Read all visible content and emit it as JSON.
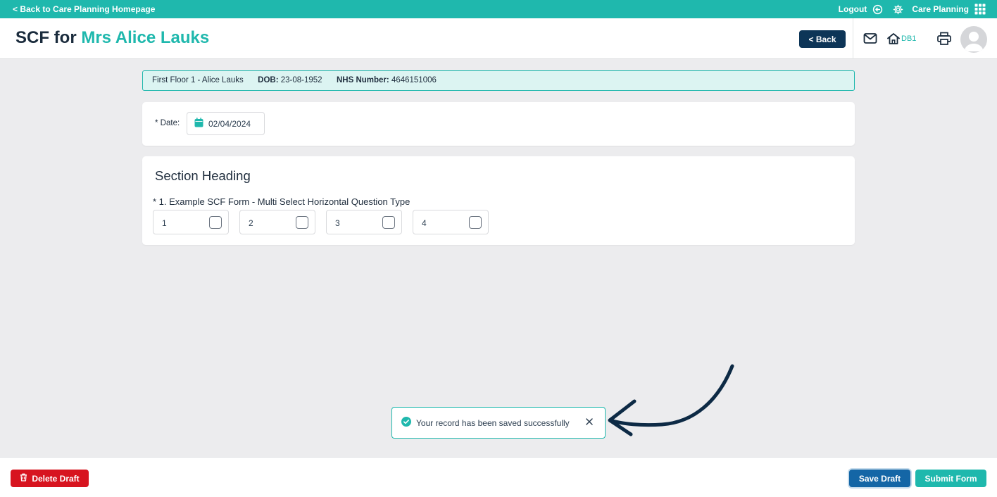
{
  "topbar": {
    "back_link": "< Back to Care Planning Homepage",
    "logout": "Logout",
    "app_name": "Care Planning"
  },
  "header": {
    "title_prefix": "SCF for",
    "patient_name": "Mrs Alice Lauks",
    "back_button": "< Back",
    "home_code": "DB1"
  },
  "patient_bar": {
    "location": "First Floor 1 - Alice Lauks",
    "dob_label": "DOB:",
    "dob_value": "23-08-1952",
    "nhs_label": "NHS Number:",
    "nhs_value": "4646151006"
  },
  "date_field": {
    "label": "* Date:",
    "value": "02/04/2024"
  },
  "section": {
    "heading": "Section Heading",
    "question": "* 1. Example SCF Form - Multi Select Horizontal Question Type",
    "options": [
      {
        "label": "1",
        "checked": false
      },
      {
        "label": "2",
        "checked": false
      },
      {
        "label": "3",
        "checked": false
      },
      {
        "label": "4",
        "checked": false
      }
    ]
  },
  "toast": {
    "message": "Your record has been saved successfully"
  },
  "footer": {
    "delete_label": "Delete Draft",
    "save_label": "Save Draft",
    "submit_label": "Submit Form"
  },
  "colors": {
    "accent": "#1fb8ad",
    "navy": "#0d3557",
    "danger": "#d7141f",
    "save_blue": "#1466a6"
  },
  "icons": [
    "logout-icon",
    "gear-icon",
    "apps-grid-icon",
    "mail-icon",
    "home-icon",
    "printer-icon",
    "avatar-icon",
    "calendar-icon",
    "check-circle-icon",
    "close-icon",
    "trash-icon",
    "arrow-annotation"
  ]
}
